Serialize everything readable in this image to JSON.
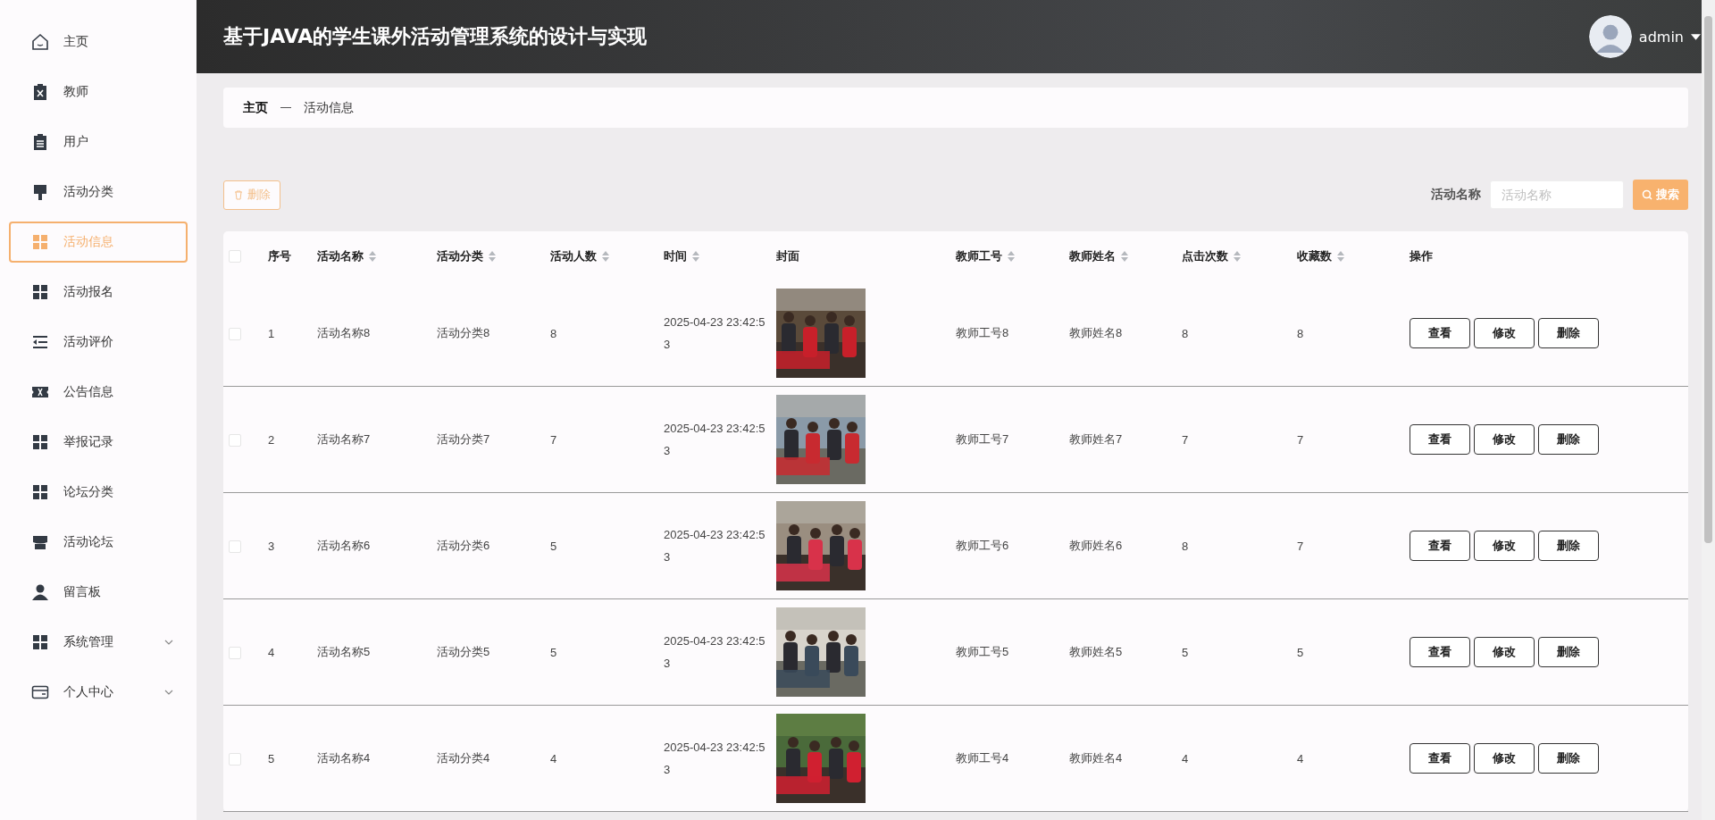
{
  "sidebar": {
    "items": [
      {
        "label": "主页",
        "selected": false,
        "expandable": false
      },
      {
        "label": "教师",
        "selected": false,
        "expandable": false
      },
      {
        "label": "用户",
        "selected": false,
        "expandable": false
      },
      {
        "label": "活动分类",
        "selected": false,
        "expandable": false
      },
      {
        "label": "活动信息",
        "selected": true,
        "expandable": false
      },
      {
        "label": "活动报名",
        "selected": false,
        "expandable": false
      },
      {
        "label": "活动评价",
        "selected": false,
        "expandable": false
      },
      {
        "label": "公告信息",
        "selected": false,
        "expandable": false
      },
      {
        "label": "举报记录",
        "selected": false,
        "expandable": false
      },
      {
        "label": "论坛分类",
        "selected": false,
        "expandable": false
      },
      {
        "label": "活动论坛",
        "selected": false,
        "expandable": false
      },
      {
        "label": "留言板",
        "selected": false,
        "expandable": false
      },
      {
        "label": "系统管理",
        "selected": false,
        "expandable": true
      },
      {
        "label": "个人中心",
        "selected": false,
        "expandable": true
      }
    ]
  },
  "header": {
    "title": "基于JAVA的学生课外活动管理系统的设计与实现",
    "user": "admin"
  },
  "breadcrumb": [
    "主页",
    "活动信息"
  ],
  "toolbar": {
    "delete_button": "删除",
    "search_label": "活动名称",
    "search": {
      "placeholder": "活动名称"
    },
    "search_button": "搜索"
  },
  "table": {
    "select_all": {
      "checked": false
    },
    "columns": [
      {
        "label": "序号",
        "sortable": false
      },
      {
        "label": "活动名称",
        "sortable": true
      },
      {
        "label": "活动分类",
        "sortable": true
      },
      {
        "label": "活动人数",
        "sortable": true
      },
      {
        "label": "时间",
        "sortable": true
      },
      {
        "label": "封面",
        "sortable": false
      },
      {
        "label": "教师工号",
        "sortable": true
      },
      {
        "label": "教师姓名",
        "sortable": true
      },
      {
        "label": "点击次数",
        "sortable": true
      },
      {
        "label": "收藏数",
        "sortable": true
      },
      {
        "label": "操作",
        "sortable": false
      }
    ],
    "rows": [
      {
        "checked": false,
        "cells": [
          "1",
          "活动名称8",
          "活动分类8",
          "8",
          "2025-04-23 23:42:53",
          "",
          "教师工号8",
          "教师姓名8",
          "8",
          "8"
        ],
        "actions": [
          "查看",
          "修改",
          "删除"
        ]
      },
      {
        "checked": false,
        "cells": [
          "2",
          "活动名称7",
          "活动分类7",
          "7",
          "2025-04-23 23:42:53",
          "",
          "教师工号7",
          "教师姓名7",
          "7",
          "7"
        ],
        "actions": [
          "查看",
          "修改",
          "删除"
        ]
      },
      {
        "checked": false,
        "cells": [
          "3",
          "活动名称6",
          "活动分类6",
          "5",
          "2025-04-23 23:42:53",
          "",
          "教师工号6",
          "教师姓名6",
          "8",
          "7"
        ],
        "actions": [
          "查看",
          "修改",
          "删除"
        ]
      },
      {
        "checked": false,
        "cells": [
          "4",
          "活动名称5",
          "活动分类5",
          "5",
          "2025-04-23 23:42:53",
          "",
          "教师工号5",
          "教师姓名5",
          "5",
          "5"
        ],
        "actions": [
          "查看",
          "修改",
          "删除"
        ]
      },
      {
        "checked": false,
        "cells": [
          "5",
          "活动名称4",
          "活动分类4",
          "4",
          "2025-04-23 23:42:53",
          "",
          "教师工号4",
          "教师姓名4",
          "4",
          "4"
        ],
        "actions": [
          "查看",
          "修改",
          "删除"
        ]
      }
    ]
  }
}
